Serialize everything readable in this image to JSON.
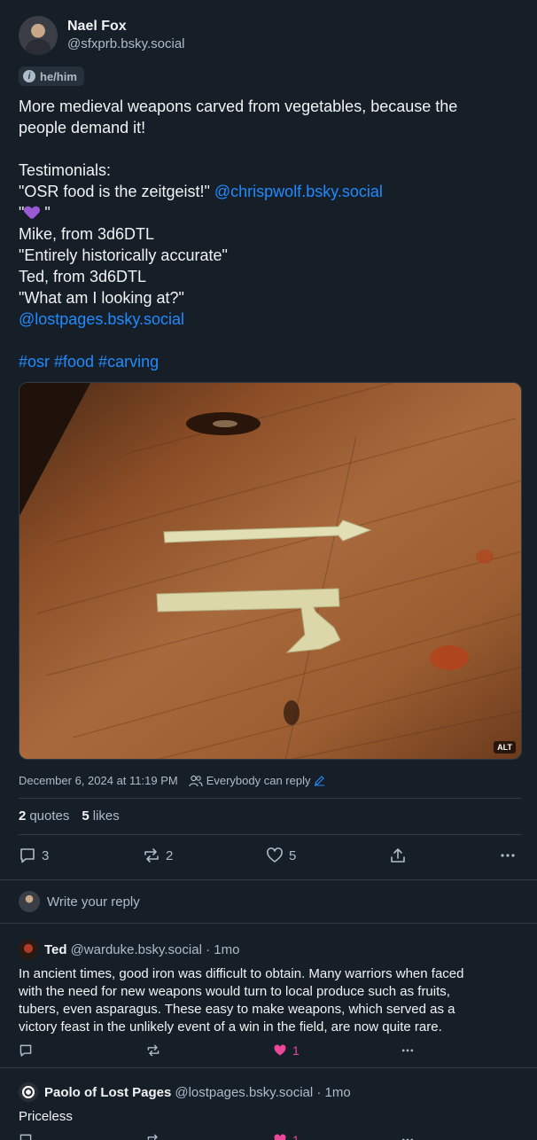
{
  "author": {
    "display_name": "Nael Fox",
    "handle": "@sfxprb.bsky.social",
    "pronouns": "he/him"
  },
  "post": {
    "lines": [
      "More medieval weapons carved from vegetables, because the",
      "people demand it!",
      "",
      "Testimonials:",
      "\"OSR food is the zeitgeist!\" ",
      "\"",
      "Mike, from 3d6DTL",
      "\"Entirely historically accurate\"",
      "Ted, from 3d6DTL",
      "\"What am I looking at?\""
    ],
    "mention_1": "@chrispwolf.bsky.social",
    "emoji_line_end": " \"",
    "mention_2": "@lostpages.bsky.social",
    "hashtags": "#osr #food #carving",
    "image_alt_badge": "ALT",
    "timestamp": "December 6, 2024 at 11:19 PM",
    "reply_setting": "Everybody can reply"
  },
  "stats": {
    "quotes_count": "2",
    "quotes_label": "quotes",
    "likes_count": "5",
    "likes_label": "likes"
  },
  "actions": {
    "replies": "3",
    "reposts": "2",
    "likes": "5"
  },
  "compose": {
    "placeholder": "Write your reply"
  },
  "replies": [
    {
      "name": "Ted",
      "handle": "@warduke.bsky.social · 1mo",
      "text": [
        "In ancient times, good iron was difficult to obtain. Many warriors when faced",
        "with the need for new weapons would turn to local produce such as fruits,",
        "tubers, even asparagus. These easy to make weapons, which served as a",
        "victory feast in the unlikely event of a win in the field, are now quite rare."
      ],
      "likes": "1"
    },
    {
      "name": "Paolo of Lost Pages",
      "handle": "@lostpages.bsky.social · 1mo",
      "text": [
        "Priceless"
      ],
      "likes": "1"
    }
  ],
  "colors": {
    "background": "#161e27",
    "link": "#208bfe",
    "muted": "#aebbc9",
    "like": "#ec4899",
    "emoji_heart": "#9b59d6"
  },
  "icons": [
    "reply-icon",
    "repost-icon",
    "heart-icon",
    "share-icon",
    "more-icon",
    "people-icon",
    "pencil-icon"
  ]
}
